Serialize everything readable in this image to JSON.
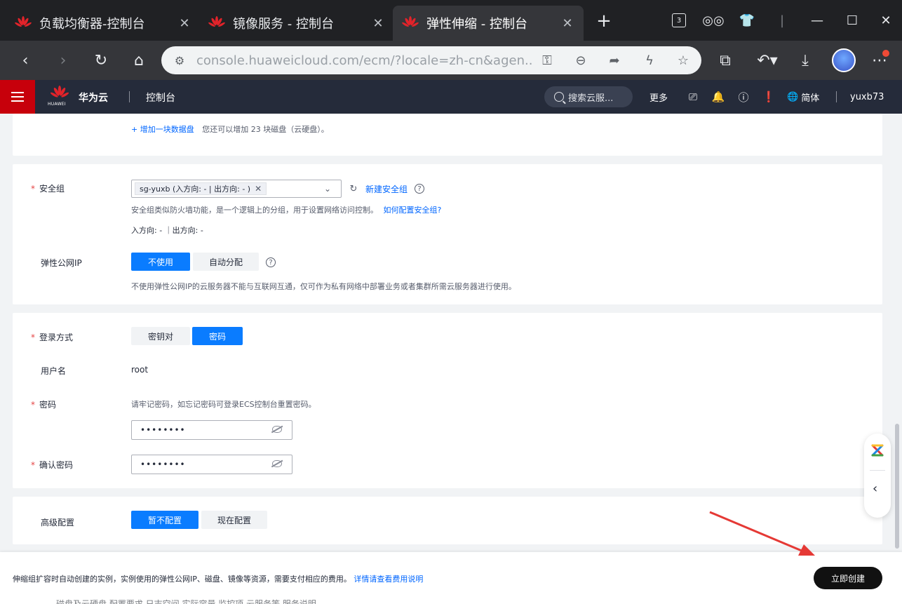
{
  "browser": {
    "tabs": [
      {
        "title": "负载均衡器-控制台",
        "active": false
      },
      {
        "title": "镜像服务 - 控制台",
        "active": false
      },
      {
        "title": "弹性伸缩 - 控制台",
        "active": true
      }
    ],
    "tab_count_badge": "3",
    "url": "console.huaweicloud.com/ecm/?locale=zh-cn&agen..."
  },
  "header": {
    "brand": "华为云",
    "logo_text": "HUAWEI",
    "console": "控制台",
    "search_placeholder": "搜索云服...",
    "more": "更多",
    "lang": "简体",
    "user": "yuxb73"
  },
  "disk": {
    "add_link": "+ 增加一块数据盘",
    "add_hint": "您还可以增加 23 块磁盘（云硬盘）。"
  },
  "security_group": {
    "label": "安全组",
    "selected_chip": "sg-yuxb (入方向: - | 出方向: - )",
    "new_link": "新建安全组",
    "desc": "安全组类似防火墙功能，是一个逻辑上的分组，用于设置网络访问控制。",
    "how_link": "如何配置安全组?",
    "rules": "入方向: - ｜出方向: -"
  },
  "eip": {
    "label": "弹性公网IP",
    "options": [
      "不使用",
      "自动分配"
    ],
    "selected": "不使用",
    "desc": "不使用弹性公网IP的云服务器不能与互联网互通，仅可作为私有网络中部署业务或者集群所需云服务器进行使用。"
  },
  "login": {
    "label": "登录方式",
    "options": [
      "密钥对",
      "密码"
    ],
    "selected": "密码",
    "username_label": "用户名",
    "username": "root",
    "password_label": "密码",
    "password_hint": "请牢记密码，如忘记密码可登录ECS控制台重置密码。",
    "password_value": "••••••••",
    "confirm_label": "确认密码",
    "confirm_value": "••••••••"
  },
  "advanced": {
    "label": "高级配置",
    "options": [
      "暂不配置",
      "现在配置"
    ],
    "selected": "暂不配置"
  },
  "footer": {
    "note": "伸缩组扩容时自动创建的实例，实例使用的弹性公网IP、磁盘、镜像等资源，需要支付相应的费用。",
    "fee_link": "详情请查看费用说明",
    "create_button": "立即创建",
    "peek_text": "磁盘及云硬盘  配置要求  日志空间  实际容量  监控项  云服务等  服务说明"
  },
  "colors": {
    "primary": "#0a7cff",
    "huawei_red": "#c7000b",
    "header_bg": "#252b3a",
    "arrow": "#e53935"
  }
}
